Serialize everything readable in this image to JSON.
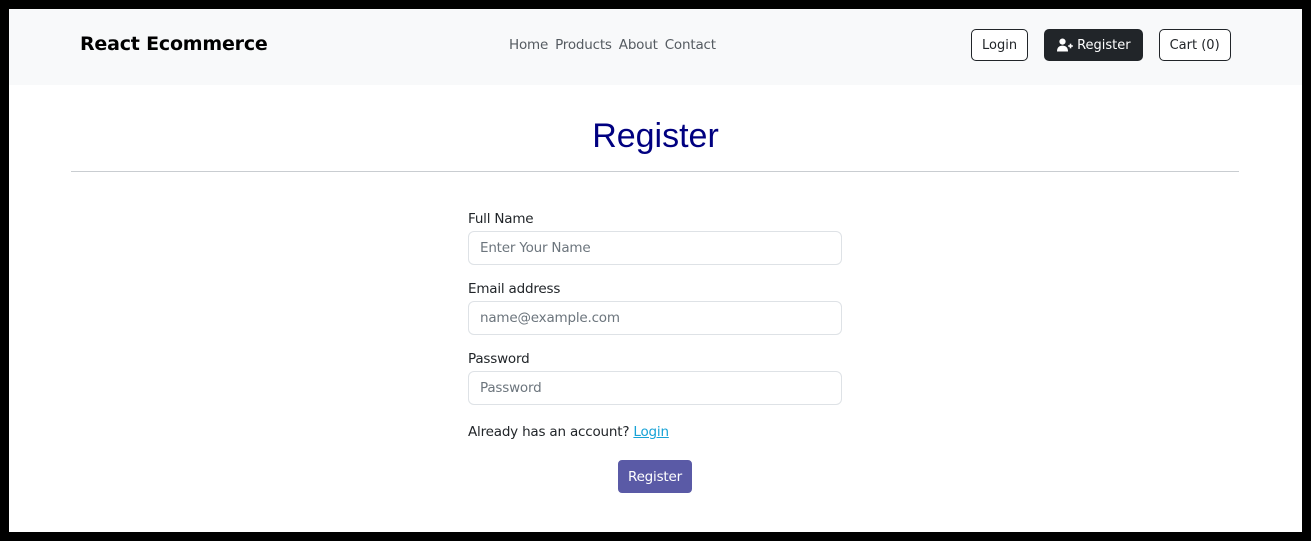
{
  "brand": "React Ecommerce",
  "nav": {
    "links": [
      "Home",
      "Products",
      "About",
      "Contact"
    ],
    "login_label": "Login",
    "register_label": "Register",
    "cart_label": "Cart (0)"
  },
  "page": {
    "title": "Register"
  },
  "form": {
    "name": {
      "label": "Full Name",
      "placeholder": "Enter Your Name",
      "value": ""
    },
    "email": {
      "label": "Email address",
      "placeholder": "name@example.com",
      "value": ""
    },
    "password": {
      "label": "Password",
      "placeholder": "Password",
      "value": ""
    },
    "account_text": "Already has an account?",
    "login_link": "Login",
    "submit_label": "Register"
  },
  "icons": {
    "register": "user-plus-icon"
  },
  "colors": {
    "title": "#000080",
    "submit": "#5a5aa6",
    "link": "#17a2d6",
    "dark_button": "#212529",
    "navbar": "#f8f9fa"
  }
}
